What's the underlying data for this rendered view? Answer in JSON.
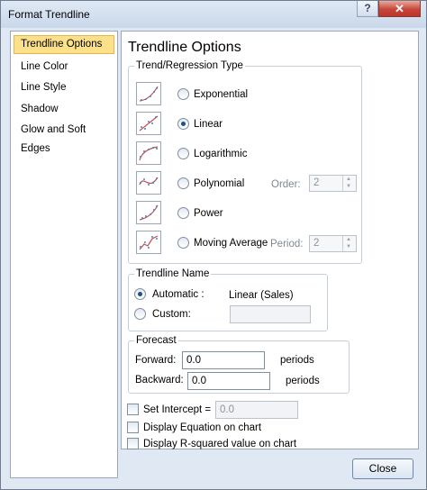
{
  "window": {
    "title": "Format Trendline",
    "help_label": "?",
    "close_glyph": "✕"
  },
  "sidebar": {
    "items": [
      {
        "label": "Trendline Options"
      },
      {
        "label": "Line Color"
      },
      {
        "label": "Line Style"
      },
      {
        "label": "Shadow"
      },
      {
        "label": "Glow and Soft Edges"
      }
    ]
  },
  "content": {
    "title": "Trendline Options",
    "type_group": {
      "legend": "Trend/Regression Type",
      "options": [
        {
          "label": "Exponential",
          "icon": "exponential-chart-icon",
          "selected": false
        },
        {
          "label": "Linear",
          "icon": "linear-chart-icon",
          "selected": true
        },
        {
          "label": "Logarithmic",
          "icon": "logarithmic-chart-icon",
          "selected": false
        },
        {
          "label": "Polynomial",
          "icon": "polynomial-chart-icon",
          "selected": false
        },
        {
          "label": "Power",
          "icon": "power-chart-icon",
          "selected": false
        },
        {
          "label": "Moving Average",
          "icon": "moving-average-chart-icon",
          "selected": false
        }
      ],
      "order_label": "Order:",
      "order_value": "2",
      "period_label": "Period:",
      "period_value": "2"
    },
    "name_group": {
      "legend": "Trendline Name",
      "automatic_label": "Automatic :",
      "automatic_value": "Linear (Sales)",
      "custom_label": "Custom:",
      "custom_value": ""
    },
    "forecast_group": {
      "legend": "Forecast",
      "forward_label": "Forward:",
      "forward_value": "0.0",
      "backward_label": "Backward:",
      "backward_value": "0.0",
      "unit": "periods"
    },
    "set_intercept_label": "Set Intercept =",
    "set_intercept_value": "0.0",
    "display_equation_label": "Display Equation on chart",
    "display_rsquared_label": "Display R-squared value on chart"
  },
  "footer": {
    "close_label": "Close"
  },
  "colors": {
    "selected_nav": "#fde18a",
    "trend_line": "#c0504d",
    "data_points": "#4f81bd"
  }
}
